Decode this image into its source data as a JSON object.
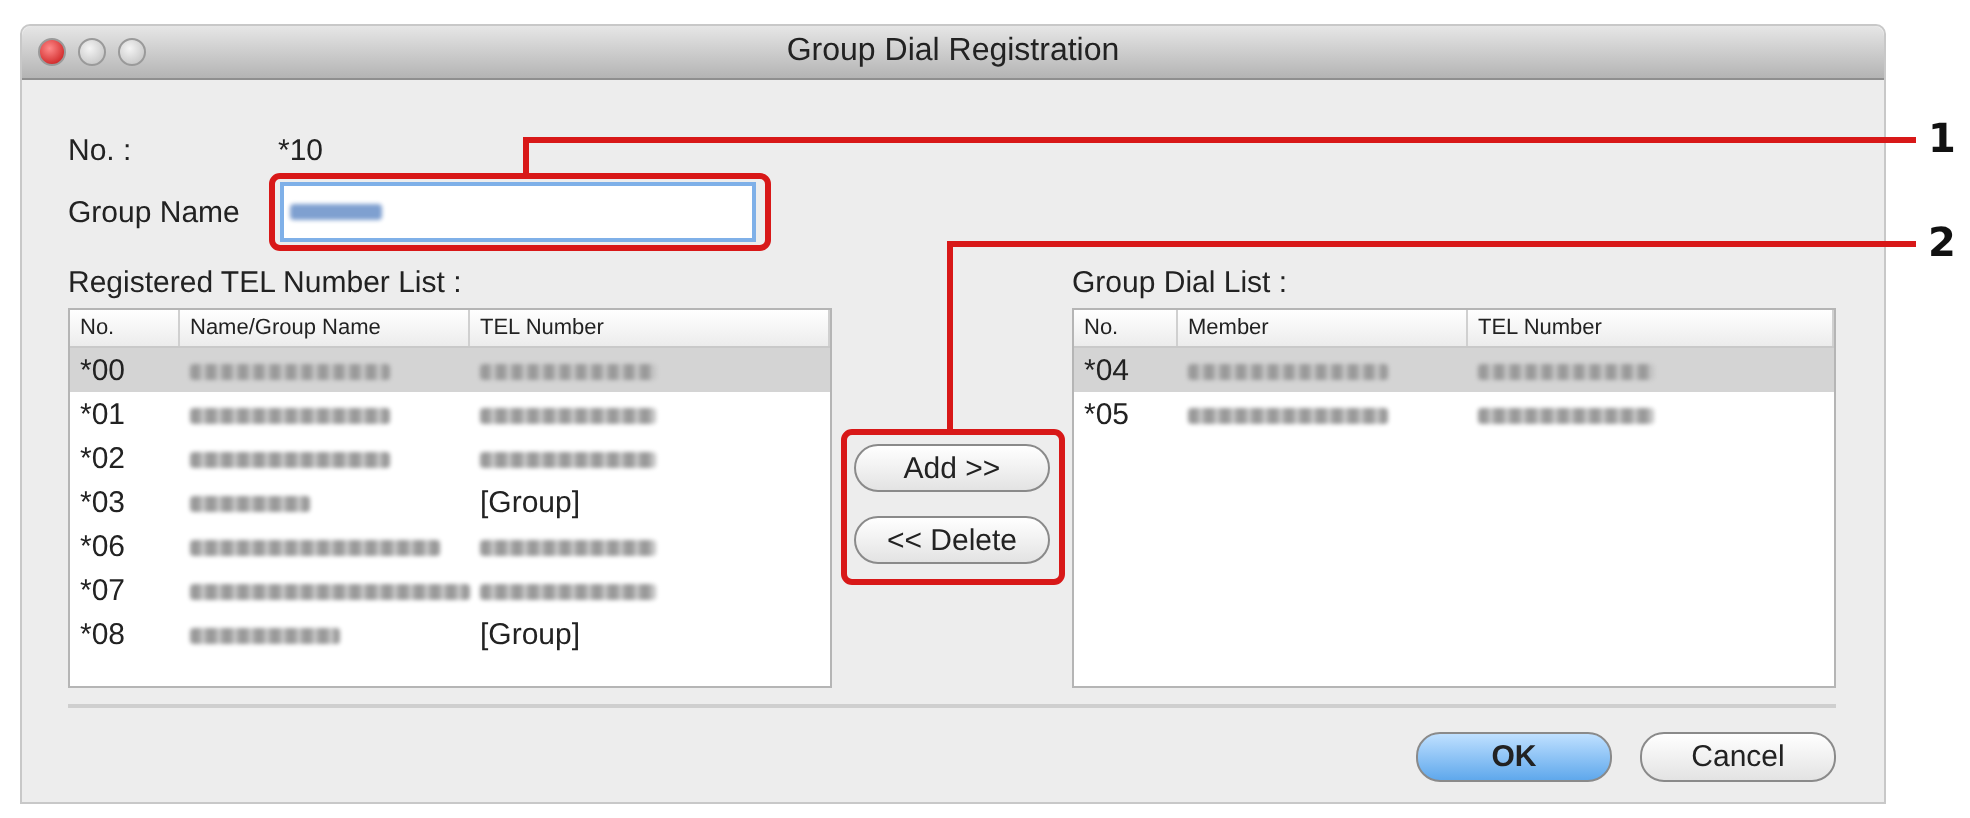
{
  "window": {
    "title": "Group Dial Registration"
  },
  "number": {
    "label": "No. :",
    "value": "*10"
  },
  "group_name": {
    "label": "Group Name",
    "value_selected": true
  },
  "registered_list": {
    "label": "Registered TEL Number List :",
    "columns": [
      "No.",
      "Name/Group Name",
      "TEL Number"
    ],
    "rows": [
      {
        "no": "*00",
        "selected": true
      },
      {
        "no": "*01",
        "selected": false
      },
      {
        "no": "*02",
        "selected": false
      },
      {
        "no": "*03",
        "tel": "[Group]",
        "selected": false
      },
      {
        "no": "*06",
        "selected": false
      },
      {
        "no": "*07",
        "selected": false
      },
      {
        "no": "*08",
        "tel": "[Group]",
        "selected": false
      }
    ]
  },
  "transfer_buttons": [
    "Add >>",
    "<< Delete"
  ],
  "group_dial_list": {
    "label": "Group Dial List :",
    "columns": [
      "No.",
      "Member",
      "TEL Number"
    ],
    "rows": [
      {
        "no": "*04",
        "selected": true
      },
      {
        "no": "*05",
        "selected": false
      }
    ]
  },
  "buttons": [
    {
      "label": "OK",
      "default": true
    },
    {
      "label": "Cancel",
      "default": false
    }
  ],
  "callouts": [
    "1",
    "2"
  ]
}
